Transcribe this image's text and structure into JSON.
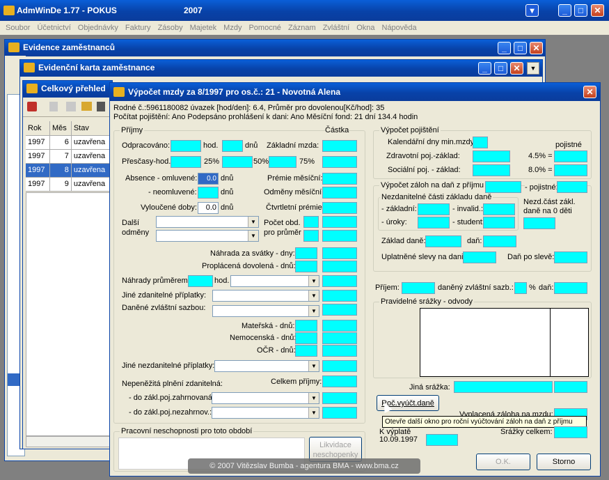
{
  "app": {
    "title": "AdmWinDe 1.77 - POKUS",
    "year": "2007"
  },
  "menu": [
    "Soubor",
    "Účetnictví",
    "Objednávky",
    "Faktury",
    "Zásoby",
    "Majetek",
    "Mzdy",
    "Pomocné",
    "Záznam",
    "Zvláštní",
    "Okna",
    "Nápověda"
  ],
  "windows": {
    "evidence": "Evidence zaměstnanců",
    "karta": "Evidenční karta zaměstnance",
    "prehled": "Celkový přehled"
  },
  "prehled": {
    "headers": [
      "Rok",
      "Měs",
      "Stav"
    ],
    "rows": [
      [
        "1997",
        "6",
        "uzavřena"
      ],
      [
        "1997",
        "7",
        "uzavřena"
      ],
      [
        "1997",
        "8",
        "uzavřena"
      ],
      [
        "1997",
        "9",
        "uzavřena"
      ]
    ]
  },
  "dialog": {
    "title": "Výpočet mzdy za  8/1997 pro os.č.:     21 - Novotná Alena",
    "info1": "Rodné č.:5961180082  úvazek [hod/den]:  6.4,  Průměr pro dovolenou[Kč/hod]:  35",
    "info2": "Počítat pojištění: Ano       Podepsáno prohlášení k dani: Ano              Měsíční fond: 21 dní  134.4 hodin",
    "prijmy": {
      "label": "Příjmy",
      "castka": "Částka",
      "odpracovano": "Odpracováno:",
      "hod": "hod.",
      "dnu": "dnů",
      "zakladni_mzda": "Základní mzda:",
      "prescasy": "Přesčasy-hod.:",
      "p25": "25%",
      "p50": "50%",
      "p75": "75%",
      "absence": "Absence - omluvené:",
      "absence_val": "0.0",
      "dnu2": "dnů",
      "premie_mes": "Prémie měsíční:",
      "neomluvene": "- neomluvené:",
      "dnu3": "dnů",
      "odmeny_mes": "Odměny měsíční:",
      "vyloucene": "Vyloučené doby:",
      "vyloucene_val": "0.0",
      "dnu4": "dnů",
      "ctvrtletni": "Čtvrtletní prémie:",
      "dalsi": "Další",
      "odmeny": "odměny",
      "pocet_obd": "Počet obd.",
      "pro_prumer": "pro průměr",
      "nahrada_svatky": "Náhrada za svátky - dny:",
      "proplacena_dov": "Proplácená dovolená - dnů:",
      "nahrady_prumerem": "Náhrady průměrem:",
      "hod2": "hod.",
      "jine_zdan": "Jiné zdanitelné příplatky:",
      "danene_zvl": "Daněné zvláštní sazbou:",
      "materska": "Mateřská - dnů:",
      "nemocenska": "Nemocenská - dnů:",
      "ocr": "OČR - dnů:",
      "jine_nezdan": "Jiné nezdanitelné příplatky:",
      "nepenezita": "Nepeněžitá plnění zdanitelná:",
      "celkem_prijmy": "Celkem příjmy:",
      "zahrnovana": "- do zákl.poj.zahrnovaná:",
      "nezahrnov": "- do zákl.poj.nezahrnov.:"
    },
    "pojisteni": {
      "label": "Výpočet pojištění",
      "kal_dny": "Kalendářní dny min.mzdy:",
      "pojistne": "pojistné",
      "zdrav": "Zdravotní poj.-základ:",
      "zdrav_pct": "4.5% =",
      "soc": "Sociální poj. - základ:",
      "soc_pct": "8.0% ="
    },
    "zalohy": {
      "label": "Výpočet záloh na daň z příjmu",
      "pojistne": "- pojistné:",
      "nezd_label": "Nezdanitelné části základu daně",
      "zakladni": "- základní:",
      "invalid": "- invalid.:",
      "uroky": "- úroky:",
      "student": "- student:",
      "nezd_deti1": "Nezd.část zákl.",
      "nezd_deti2": "daně na  0 děti",
      "zaklad_dane": "Základ daně:",
      "dan": "daň:",
      "uplat_slevy": "Uplatněné slevy na dani:",
      "dan_po_sleve": "Daň po slevě:"
    },
    "prijem_zvl": {
      "prijem": "Příjem:",
      "danene": "daněný zvláštní sazb.:",
      "pct": "%",
      "dan": "daň:"
    },
    "srazky": {
      "label": "Pravidelné srážky - odvody",
      "jina": "Jiná srážka:",
      "roc_btn": "Roč.vyúčt.daně",
      "tooltip": "Otevře další okno pro roční vyúčtování záloh na daň z příjmu",
      "vyplacena": "Vyplacená záloha na mzdu:",
      "k_vyplate": "K výplatě",
      "datum": "10.09.1997",
      "srazky_celkem": "Srážky celkem:"
    },
    "neschopnost": {
      "label": "Pracovní neschopnosti pro toto období",
      "likv1": "Likvidace",
      "likv2": "neschopenky"
    },
    "buttons": {
      "ok": "O.K.",
      "storno": "Storno"
    }
  },
  "footer": "© 2007 Vitězslav Bumba - agentura BMA - www.bma.cz"
}
